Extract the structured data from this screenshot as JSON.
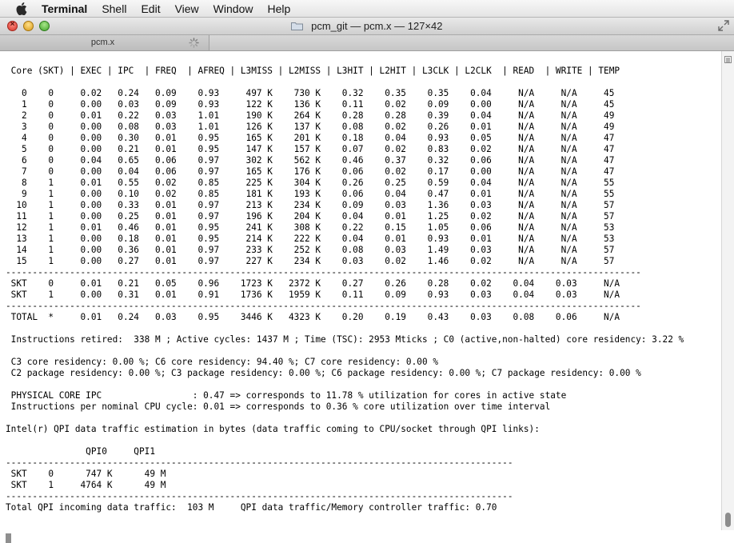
{
  "menubar": {
    "app_name": "Terminal",
    "items": [
      "Shell",
      "Edit",
      "View",
      "Window",
      "Help"
    ]
  },
  "window": {
    "title": "pcm_git — pcm.x — 127×42",
    "tab_label": "pcm.x"
  },
  "icons": {
    "apple": "apple-logo-icon",
    "folder": "folder-icon",
    "fullscreen": "fullscreen-arrows-icon",
    "spinner": "activity-spinner-icon",
    "close": "close-icon"
  },
  "terminal": {
    "lines": [
      " Core (SKT) | EXEC | IPC  | FREQ  | AFREQ | L3MISS | L2MISS | L3HIT | L2HIT | L3CLK | L2CLK  | READ  | WRITE | TEMP",
      "",
      "   0    0     0.02   0.24   0.09    0.93     497 K    730 K    0.32    0.35    0.35    0.04     N/A     N/A     45",
      "   1    0     0.00   0.03   0.09    0.93     122 K    136 K    0.11    0.02    0.09    0.00     N/A     N/A     45",
      "   2    0     0.01   0.22   0.03    1.01     190 K    264 K    0.28    0.28    0.39    0.04     N/A     N/A     49",
      "   3    0     0.00   0.08   0.03    1.01     126 K    137 K    0.08    0.02    0.26    0.01     N/A     N/A     49",
      "   4    0     0.00   0.30   0.01    0.95     165 K    201 K    0.18    0.04    0.93    0.05     N/A     N/A     47",
      "   5    0     0.00   0.21   0.01    0.95     147 K    157 K    0.07    0.02    0.83    0.02     N/A     N/A     47",
      "   6    0     0.04   0.65   0.06    0.97     302 K    562 K    0.46    0.37    0.32    0.06     N/A     N/A     47",
      "   7    0     0.00   0.04   0.06    0.97     165 K    176 K    0.06    0.02    0.17    0.00     N/A     N/A     47",
      "   8    1     0.01   0.55   0.02    0.85     225 K    304 K    0.26    0.25    0.59    0.04     N/A     N/A     55",
      "   9    1     0.00   0.10   0.02    0.85     181 K    193 K    0.06    0.04    0.47    0.01     N/A     N/A     55",
      "  10    1     0.00   0.33   0.01    0.97     213 K    234 K    0.09    0.03    1.36    0.03     N/A     N/A     57",
      "  11    1     0.00   0.25   0.01    0.97     196 K    204 K    0.04    0.01    1.25    0.02     N/A     N/A     57",
      "  12    1     0.01   0.46   0.01    0.95     241 K    308 K    0.22    0.15    1.05    0.06     N/A     N/A     53",
      "  13    1     0.00   0.18   0.01    0.95     214 K    222 K    0.04    0.01    0.93    0.01     N/A     N/A     53",
      "  14    1     0.00   0.36   0.01    0.97     233 K    252 K    0.08    0.03    1.49    0.03     N/A     N/A     57",
      "  15    1     0.00   0.27   0.01    0.97     227 K    234 K    0.03    0.02    1.46    0.02     N/A     N/A     57",
      "-----------------------------------------------------------------------------------------------------------------------",
      " SKT    0     0.01   0.21   0.05    0.96    1723 K   2372 K    0.27    0.26    0.28    0.02    0.04    0.03     N/A",
      " SKT    1     0.00   0.31   0.01    0.91    1736 K   1959 K    0.11    0.09    0.93    0.03    0.04    0.03     N/A",
      "-----------------------------------------------------------------------------------------------------------------------",
      " TOTAL  *     0.01   0.24   0.03    0.95    3446 K   4323 K    0.20    0.19    0.43    0.03    0.08    0.06     N/A",
      "",
      " Instructions retired:  338 M ; Active cycles: 1437 M ; Time (TSC): 2953 Mticks ; C0 (active,non-halted) core residency: 3.22 %",
      "",
      " C3 core residency: 0.00 %; C6 core residency: 94.40 %; C7 core residency: 0.00 %",
      " C2 package residency: 0.00 %; C3 package residency: 0.00 %; C6 package residency: 0.00 %; C7 package residency: 0.00 %",
      "",
      " PHYSICAL CORE IPC                 : 0.47 => corresponds to 11.78 % utilization for cores in active state",
      " Instructions per nominal CPU cycle: 0.01 => corresponds to 0.36 % core utilization over time interval",
      "",
      "Intel(r) QPI data traffic estimation in bytes (data traffic coming to CPU/socket through QPI links):",
      "",
      "               QPI0     QPI1",
      "-----------------------------------------------------------------------------------------------",
      " SKT    0      747 K      49 M",
      " SKT    1     4764 K      49 M",
      "-----------------------------------------------------------------------------------------------",
      "Total QPI incoming data traffic:  103 M     QPI data traffic/Memory controller traffic: 0.70"
    ]
  }
}
